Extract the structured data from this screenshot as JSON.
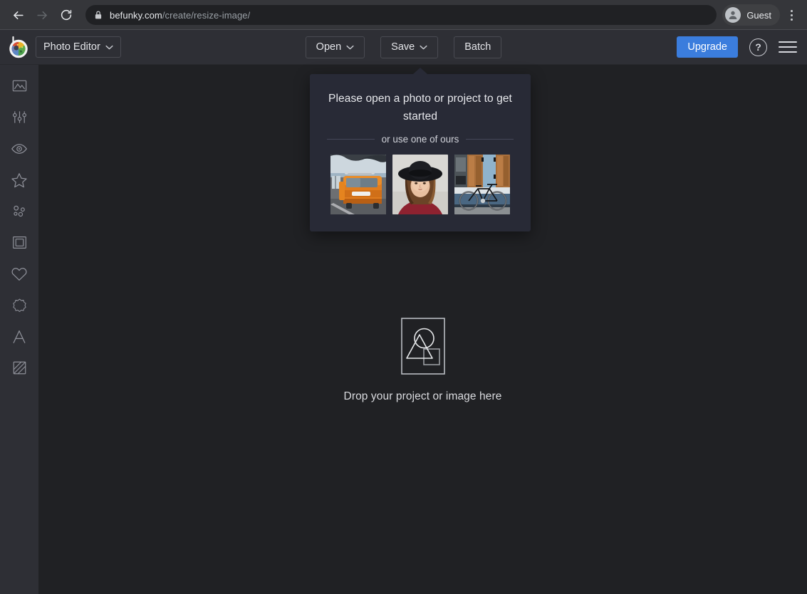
{
  "browser": {
    "back_icon": "back-arrow-icon",
    "forward_icon": "forward-arrow-icon",
    "reload_icon": "reload-icon",
    "lock_icon": "lock-icon",
    "url_host": "befunky.com",
    "url_path": "/create/resize-image/",
    "url_full": "befunky.com/create/resize-image/",
    "profile_name": "Guest",
    "profile_icon": "person-avatar-icon",
    "menu_icon": "three-dot-menu-icon"
  },
  "header": {
    "logo_name": "befunky-color-wheel-logo",
    "app_switcher_label": "Photo Editor",
    "app_switcher_caret": "chevron-down-icon",
    "open_label": "Open",
    "save_label": "Save",
    "batch_label": "Batch",
    "upgrade_label": "Upgrade",
    "help_label": "?",
    "hamburger_icon": "hamburger-menu-icon",
    "accent_color": "#3b7ddd"
  },
  "sidebar": {
    "items": [
      {
        "name": "edit",
        "icon": "image-mountain-icon",
        "label": "Edit"
      },
      {
        "name": "touchup",
        "icon": "sliders-icon",
        "label": "Touch Up"
      },
      {
        "name": "effects",
        "icon": "eye-icon",
        "label": "Effects"
      },
      {
        "name": "artsy",
        "icon": "star-icon",
        "label": "Artsy"
      },
      {
        "name": "overlays",
        "icon": "dots-cluster-icon",
        "label": "Overlays"
      },
      {
        "name": "frames",
        "icon": "frame-square-icon",
        "label": "Frames"
      },
      {
        "name": "graphics",
        "icon": "heart-icon",
        "label": "Graphics"
      },
      {
        "name": "stickers",
        "icon": "flower-burst-icon",
        "label": "Stickers"
      },
      {
        "name": "text",
        "icon": "text-a-icon",
        "label": "Text"
      },
      {
        "name": "textures",
        "icon": "texture-diagonal-icon",
        "label": "Textures"
      }
    ]
  },
  "open_popup": {
    "title": "Please open a photo or project to get started",
    "divider_text": "or use one of ours",
    "thumbnails": [
      {
        "name": "sample-orange-van",
        "alt": "Orange VW van parked at the beach"
      },
      {
        "name": "sample-woman-hat",
        "alt": "Woman wearing a black hat"
      },
      {
        "name": "sample-blue-bicycle",
        "alt": "Bicycle leaning on a blue wall"
      }
    ]
  },
  "dropzone": {
    "icon": "shapes-in-frame-icon",
    "text": "Drop your project or image here"
  },
  "colors": {
    "browser_bar": "#35363a",
    "omnibox": "#202124",
    "app_header": "#2e2f35",
    "sidebar": "#2e2f35",
    "canvas": "#202124",
    "popup": "#282a36",
    "accent": "#3b7ddd",
    "text_primary": "#e7e8ec",
    "icon_stroke": "#8e9099"
  }
}
